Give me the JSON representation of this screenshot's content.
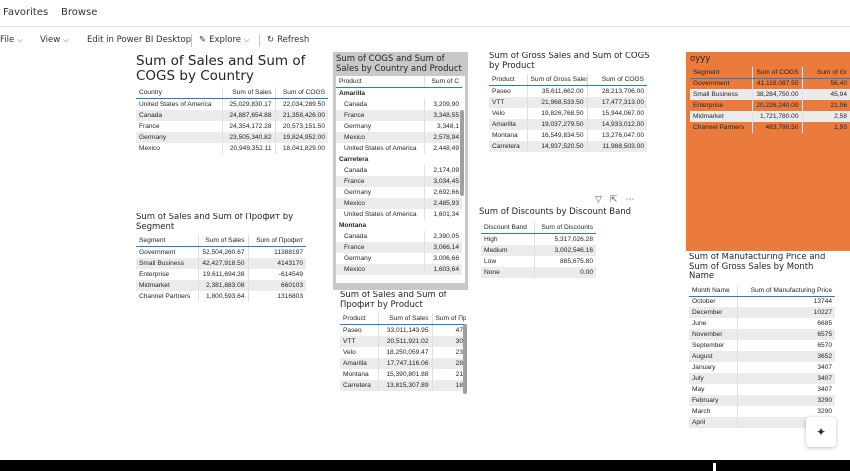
{
  "nav": {
    "favorites": "Favorites",
    "browse": "Browse"
  },
  "toolbar": {
    "file": "File",
    "view": "View",
    "edit": "Edit in Power BI Desktop",
    "explore": "Explore",
    "refresh": "Refresh"
  },
  "visuals": {
    "sales_cogs_country": {
      "title": "Sum of Sales and Sum of COGS by Country",
      "headers": [
        "Country",
        "Sum of Sales",
        "Sum of COGS"
      ],
      "rows": [
        [
          "United States of America",
          "25,029,830.17",
          "22,034,289.50"
        ],
        [
          "Canada",
          "24,887,654.88",
          "21,358,426.00"
        ],
        [
          "France",
          "24,354,172.28",
          "20,573,151.50"
        ],
        [
          "Germany",
          "23,505,340.82",
          "19,824,952.00"
        ],
        [
          "Mexico",
          "20,949,352.11",
          "18,041,829.00"
        ]
      ]
    },
    "cogs_sales_country_product": {
      "title": "Sum of COGS and Sum of Sales by Country and Product",
      "headers": [
        "Product",
        "Sum of C"
      ],
      "groups": [
        {
          "name": "Amarilla",
          "rows": [
            [
              "Canada",
              "3,209,90"
            ],
            [
              "France",
              "3,348,55"
            ],
            [
              "Germany",
              "3,348,1"
            ],
            [
              "Mexico",
              "2,578,94"
            ],
            [
              "United States of America",
              "2,448,49"
            ]
          ]
        },
        {
          "name": "Carretera",
          "rows": [
            [
              "Canada",
              "2,174,09"
            ],
            [
              "France",
              "3,034,45"
            ],
            [
              "Germany",
              "2,692,66"
            ],
            [
              "Mexico",
              "2,485,93"
            ],
            [
              "United States of America",
              "1,601,34"
            ]
          ]
        },
        {
          "name": "Montana",
          "rows": [
            [
              "Canada",
              "2,390,05"
            ],
            [
              "France",
              "3,066,14"
            ],
            [
              "Germany",
              "3,006,66"
            ],
            [
              "Mexico",
              "1,603,64"
            ]
          ]
        }
      ]
    },
    "gross_sales_cogs_product": {
      "title": "Sum of Gross Sales and Sum of COGS by Product",
      "headers": [
        "Product",
        "Sum of Gross Sales",
        "Sum of COGS"
      ],
      "rows": [
        [
          "Paseo",
          "35,611,662.00",
          "28,213,706.00"
        ],
        [
          "VTT",
          "21,968,533.50",
          "17,477,313.00"
        ],
        [
          "Velo",
          "19,826,768.50",
          "15,944,067.00"
        ],
        [
          "Amarilla",
          "19,037,279.50",
          "14,933,012.00"
        ],
        [
          "Montana",
          "16,549,834.50",
          "13,276,047.00"
        ],
        [
          "Carretera",
          "14,937,520.50",
          "11,988,503.00"
        ]
      ]
    },
    "oyyy": {
      "title": "oyyy",
      "headers": [
        "Segment",
        "Sum of COGS",
        "Sum of Gr"
      ],
      "rows": [
        [
          "Government",
          "41,116,087.50",
          "56,40"
        ],
        [
          "Small Business",
          "38,284,750.00",
          "45,94"
        ],
        [
          "Enterprise",
          "20,226,240.00",
          "21,06"
        ],
        [
          "Midmarket",
          "1,721,780.00",
          "2,58"
        ],
        [
          "Channel Partners",
          "483,790.50",
          "1,93"
        ]
      ]
    },
    "sales_profit_segment": {
      "title": "Sum of Sales and Sum of Профит by Segment",
      "headers": [
        "Segment",
        "Sum of Sales",
        "Sum of Профит"
      ],
      "rows": [
        [
          "Government",
          "52,504,260.67",
          "11388197"
        ],
        [
          "Small Business",
          "42,427,918.50",
          "4143170"
        ],
        [
          "Enterprise",
          "19,611,694.38",
          "-614549"
        ],
        [
          "Midmarket",
          "2,381,883.08",
          "660103"
        ],
        [
          "Channel Partners",
          "1,800,593.64",
          "1316803"
        ]
      ]
    },
    "discounts_band": {
      "title": "Sum of Discounts by Discount Band",
      "headers": [
        "Discount Band",
        "Sum of Discounts"
      ],
      "rows": [
        [
          "High",
          "5,317,026.28"
        ],
        [
          "Medium",
          "3,002,546.16"
        ],
        [
          "Low",
          "885,675.80"
        ],
        [
          "None",
          "0.00"
        ]
      ]
    },
    "sales_profit_product": {
      "title": "Sum of Sales and Sum of Профит by Product",
      "headers": [
        "Product",
        "Sum of Sales",
        "Sum of Пр"
      ],
      "rows": [
        [
          "Paseo",
          "33,011,143.95",
          "47"
        ],
        [
          "VTT",
          "20,511,921.02",
          "30"
        ],
        [
          "Velo",
          "18,250,059.47",
          "23"
        ],
        [
          "Amarilla",
          "17,747,116.06",
          "28"
        ],
        [
          "Montana",
          "15,390,801.88",
          "21"
        ],
        [
          "Carretera",
          "13,815,307.89",
          "18"
        ]
      ]
    },
    "manufacturing_month": {
      "title": "Sum of Manufacturing Price and Sum of Gross Sales by Month Name",
      "headers": [
        "Month Name",
        "Sum of Manufacturing Price"
      ],
      "rows": [
        [
          "October",
          "13744"
        ],
        [
          "December",
          "10227"
        ],
        [
          "June",
          "6685"
        ],
        [
          "November",
          "6575"
        ],
        [
          "September",
          "6570"
        ],
        [
          "August",
          "3652"
        ],
        [
          "January",
          "3407"
        ],
        [
          "July",
          "3407"
        ],
        [
          "May",
          "3407"
        ],
        [
          "February",
          "3290"
        ],
        [
          "March",
          "3290"
        ],
        [
          "April",
          ""
        ]
      ]
    }
  },
  "colors": {
    "accent": "#2b7bc4",
    "orange": "#ea7b3c",
    "selected": "#c8c8c8"
  }
}
